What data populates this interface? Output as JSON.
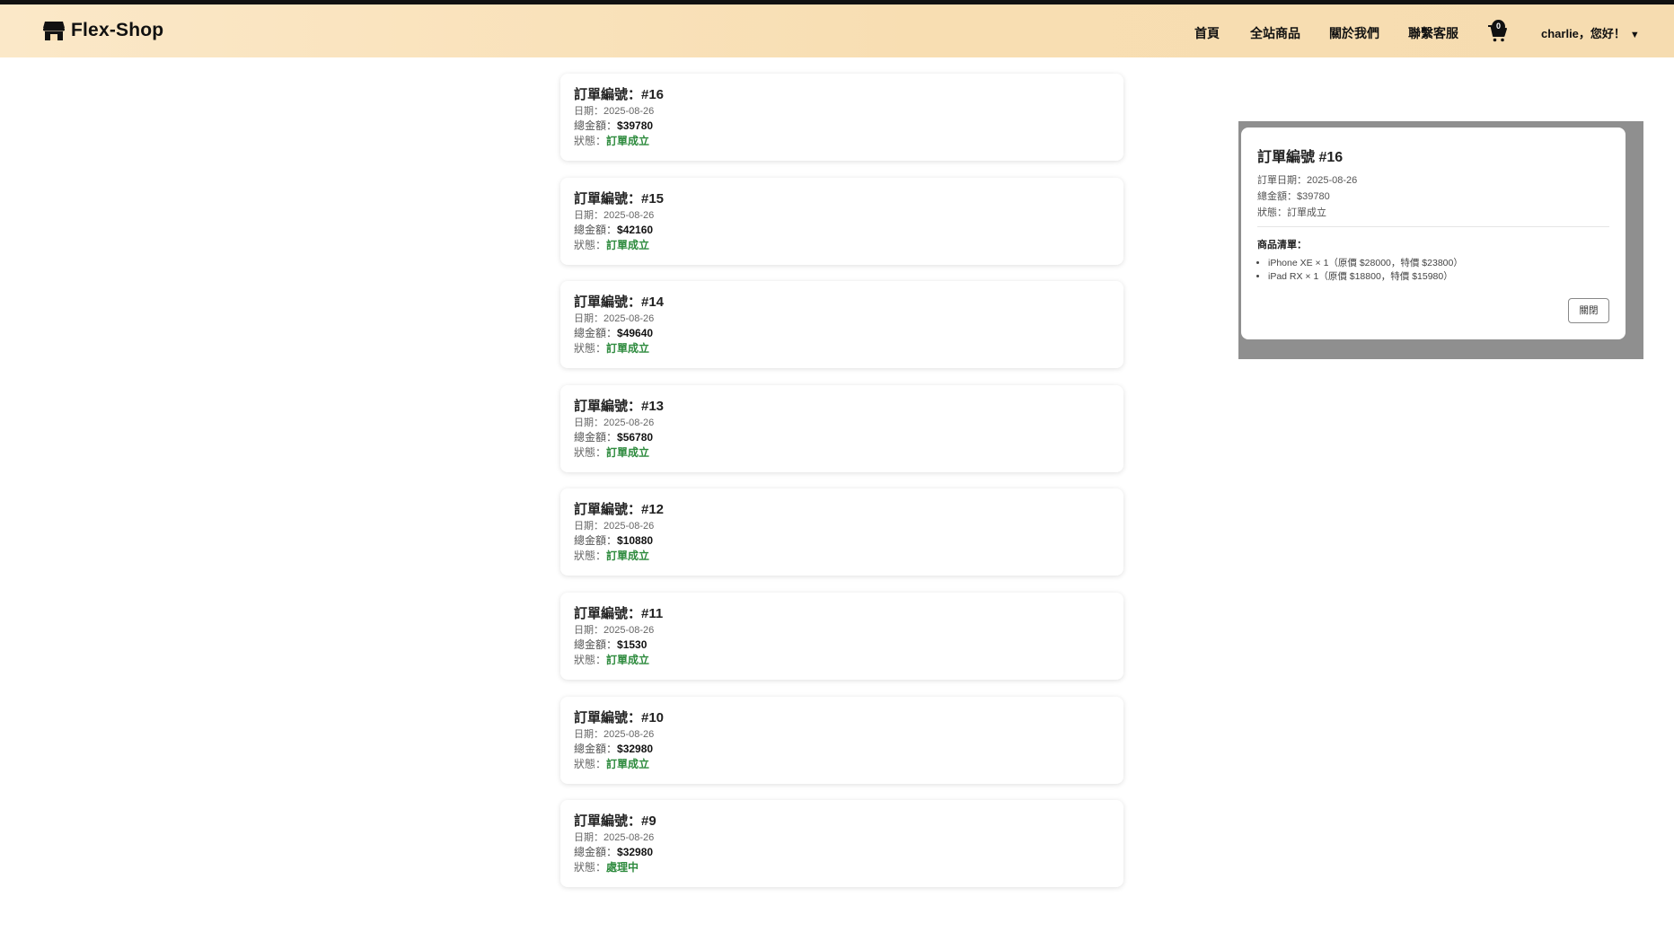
{
  "brand": {
    "name": "Flex-Shop",
    "icon": "store-icon"
  },
  "nav": {
    "links": [
      "首頁",
      "全站商品",
      "關於我們",
      "聯繫客服"
    ],
    "cart_count": "0",
    "user_label": "charlie，您好！",
    "user_caret": "▼"
  },
  "orders": [
    {
      "title": "訂單編號：#16",
      "date_label": "日期：",
      "date": "2025-08-26",
      "total_label": "總金額：",
      "total": "$39780",
      "status_label": "狀態：",
      "status": "訂單成立"
    },
    {
      "title": "訂單編號：#15",
      "date_label": "日期：",
      "date": "2025-08-26",
      "total_label": "總金額：",
      "total": "$42160",
      "status_label": "狀態：",
      "status": "訂單成立"
    },
    {
      "title": "訂單編號：#14",
      "date_label": "日期：",
      "date": "2025-08-26",
      "total_label": "總金額：",
      "total": "$49640",
      "status_label": "狀態：",
      "status": "訂單成立"
    },
    {
      "title": "訂單編號：#13",
      "date_label": "日期：",
      "date": "2025-08-26",
      "total_label": "總金額：",
      "total": "$56780",
      "status_label": "狀態：",
      "status": "訂單成立"
    },
    {
      "title": "訂單編號：#12",
      "date_label": "日期：",
      "date": "2025-08-26",
      "total_label": "總金額：",
      "total": "$10880",
      "status_label": "狀態：",
      "status": "訂單成立"
    },
    {
      "title": "訂單編號：#11",
      "date_label": "日期：",
      "date": "2025-08-26",
      "total_label": "總金額：",
      "total": "$1530",
      "status_label": "狀態：",
      "status": "訂單成立"
    },
    {
      "title": "訂單編號：#10",
      "date_label": "日期：",
      "date": "2025-08-26",
      "total_label": "總金額：",
      "total": "$32980",
      "status_label": "狀態：",
      "status": "訂單成立"
    },
    {
      "title": "訂單編號：#9",
      "date_label": "日期：",
      "date": "2025-08-26",
      "total_label": "總金額：",
      "total": "$32980",
      "status_label": "狀態：",
      "status": "處理中"
    }
  ],
  "modal": {
    "title": "訂單編號 #16",
    "date_line": "訂單日期：2025-08-26",
    "total_line": "總金額：$39780",
    "status_line": "狀態：訂單成立",
    "items_label": "商品清單：",
    "items": [
      "iPhone XE × 1（原價 $28000，特價 $23800）",
      "iPad RX × 1（原價 $18800，特價 $15980）"
    ],
    "close_label": "關閉"
  },
  "colors": {
    "status_green": "#2e8b3e",
    "nav_bg_start": "#fbe8c8",
    "nav_bg_end": "#f6dcb0"
  }
}
